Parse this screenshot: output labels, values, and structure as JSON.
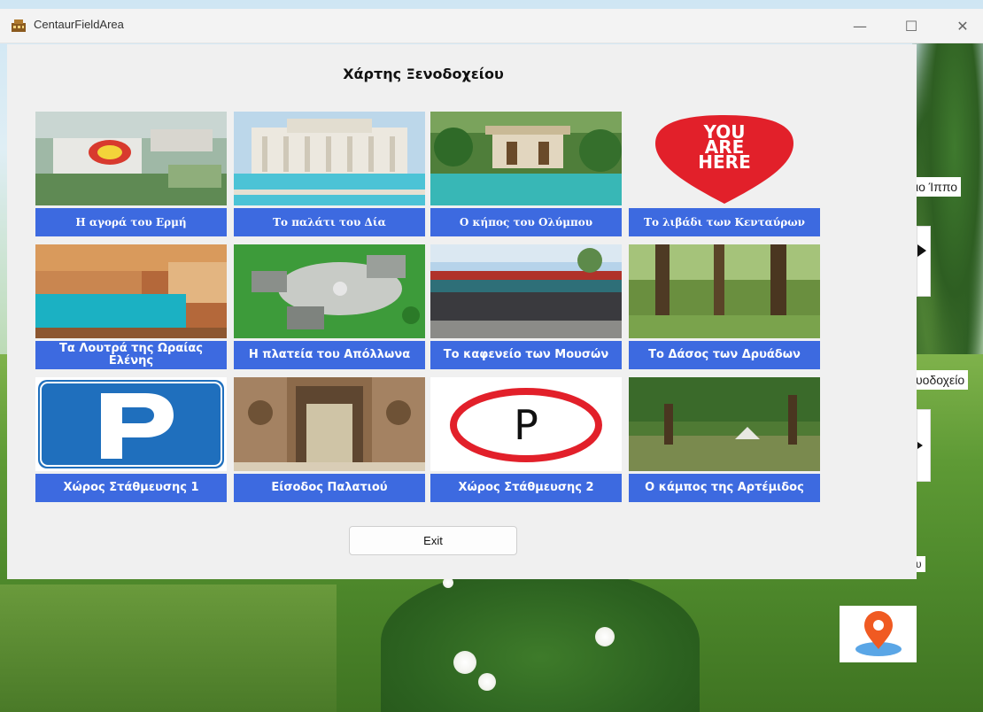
{
  "window": {
    "title": "CentaurFieldArea",
    "minimize": "—",
    "maximize": "☐",
    "close": "✕"
  },
  "background": {
    "label_1": "ιο Ίππο",
    "label_2": "υοδοχείο",
    "label_3": "υ"
  },
  "dialog": {
    "title": "Χάρτης Ξενοδοχείου",
    "tiles": [
      {
        "label": "Η αγορά του Ερμή"
      },
      {
        "label": "Το παλάτι του Δία"
      },
      {
        "label": "Ο κήπος του Ολύμπου"
      },
      {
        "label": "Το λιβάδι των Κενταύρων"
      },
      {
        "label": "Τα Λουτρά της Ωραίας Ελένης"
      },
      {
        "label": "Η πλατεία του Απόλλωνα"
      },
      {
        "label": "Το καφενείο των Μουσών"
      },
      {
        "label": "Το Δάσος των Δρυάδων"
      },
      {
        "label": "Χώρος Στάθμευσης 1"
      },
      {
        "label": "Είσοδος Παλατιού"
      },
      {
        "label": "Χώρος Στάθμευσης 2"
      },
      {
        "label": "Ο κάμπος της Αρτέμιδος"
      }
    ],
    "you_are_here": [
      "YOU",
      "ARE",
      "HERE"
    ],
    "parking_letter": "P",
    "exit_label": "Exit"
  },
  "colors": {
    "caption_blue": "#3d6ae0",
    "marker_orange": "#f05a22",
    "you_are_here_red": "#e2202a"
  }
}
